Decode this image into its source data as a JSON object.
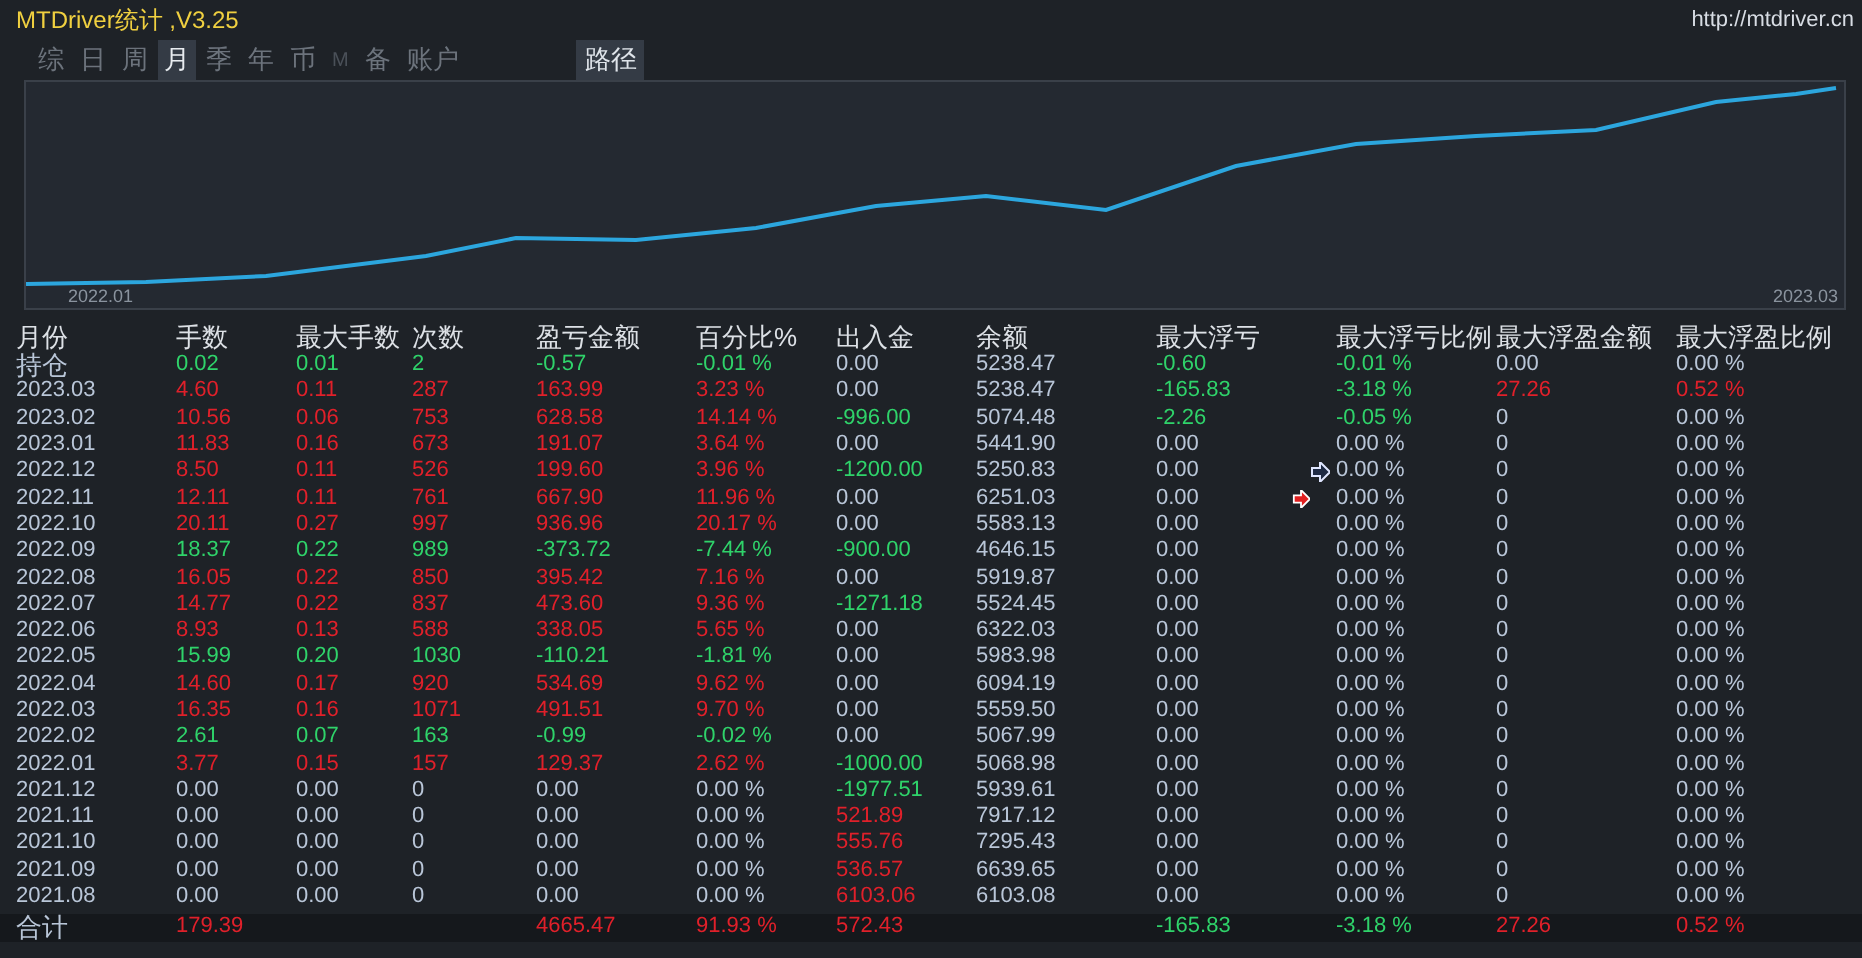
{
  "window": {
    "title": "MTDriver统计 ,V3.25",
    "url": "http://mtdriver.cn"
  },
  "tabs": [
    {
      "label": "综",
      "selected": false,
      "disabled": false
    },
    {
      "label": "日",
      "selected": false,
      "disabled": false
    },
    {
      "label": "周",
      "selected": false,
      "disabled": false
    },
    {
      "label": "月",
      "selected": true,
      "disabled": false
    },
    {
      "label": "季",
      "selected": false,
      "disabled": false
    },
    {
      "label": "年",
      "selected": false,
      "disabled": false
    },
    {
      "label": "币",
      "selected": false,
      "disabled": false
    },
    {
      "label": "M",
      "selected": false,
      "disabled": true
    },
    {
      "label": "备",
      "selected": false,
      "disabled": false
    },
    {
      "label": "账户",
      "selected": false,
      "disabled": false
    }
  ],
  "path_button": "路径",
  "chart": {
    "x_start": "2022.01",
    "x_end": "2023.03"
  },
  "table": {
    "columns": [
      "月份",
      "手数",
      "最大手数",
      "次数",
      "盈亏金额",
      "百分比%",
      "出入金",
      "余额",
      "最大浮亏",
      "最大浮亏比例",
      "最大浮盈金额",
      "最大浮盈比例"
    ],
    "rows": [
      {
        "cells": [
          {
            "text": "持仓",
            "color": "#b9c6d8"
          },
          {
            "text": "0.02",
            "color": "#2fd36a"
          },
          {
            "text": "0.01",
            "color": "#2fd36a"
          },
          {
            "text": "2",
            "color": "#2fd36a"
          },
          {
            "text": "-0.57",
            "color": "#2fd36a"
          },
          {
            "text": "-0.01 %",
            "color": "#2fd36a"
          },
          {
            "text": "0.00",
            "color": "#b9c6d8"
          },
          {
            "text": "5238.47",
            "color": "#b9c6d8"
          },
          {
            "text": "-0.60",
            "color": "#2fd36a"
          },
          {
            "text": "-0.01 %",
            "color": "#2fd36a"
          },
          {
            "text": "0.00",
            "color": "#b9c6d8"
          },
          {
            "text": "0.00 %",
            "color": "#b9c6d8"
          }
        ]
      },
      {
        "cells": [
          {
            "text": "2023.03",
            "color": "#b9c6d8"
          },
          {
            "text": "4.60",
            "color": "#e0202a"
          },
          {
            "text": "0.11",
            "color": "#e0202a"
          },
          {
            "text": "287",
            "color": "#e0202a"
          },
          {
            "text": "163.99",
            "color": "#e0202a"
          },
          {
            "text": "3.23 %",
            "color": "#e0202a"
          },
          {
            "text": "0.00",
            "color": "#b9c6d8"
          },
          {
            "text": "5238.47",
            "color": "#b9c6d8"
          },
          {
            "text": "-165.83",
            "color": "#2fd36a"
          },
          {
            "text": "-3.18 %",
            "color": "#2fd36a"
          },
          {
            "text": "27.26",
            "color": "#e0202a"
          },
          {
            "text": "0.52 %",
            "color": "#e0202a"
          }
        ]
      },
      {
        "cells": [
          {
            "text": "2023.02",
            "color": "#b9c6d8"
          },
          {
            "text": "10.56",
            "color": "#e0202a"
          },
          {
            "text": "0.06",
            "color": "#e0202a"
          },
          {
            "text": "753",
            "color": "#e0202a"
          },
          {
            "text": "628.58",
            "color": "#e0202a"
          },
          {
            "text": "14.14 %",
            "color": "#e0202a"
          },
          {
            "text": "-996.00",
            "color": "#2fd36a"
          },
          {
            "text": "5074.48",
            "color": "#b9c6d8"
          },
          {
            "text": "-2.26",
            "color": "#2fd36a"
          },
          {
            "text": "-0.05 %",
            "color": "#2fd36a"
          },
          {
            "text": "0",
            "color": "#b9c6d8"
          },
          {
            "text": "0.00 %",
            "color": "#b9c6d8"
          }
        ]
      },
      {
        "cells": [
          {
            "text": "2023.01",
            "color": "#b9c6d8"
          },
          {
            "text": "11.83",
            "color": "#e0202a"
          },
          {
            "text": "0.16",
            "color": "#e0202a"
          },
          {
            "text": "673",
            "color": "#e0202a"
          },
          {
            "text": "191.07",
            "color": "#e0202a"
          },
          {
            "text": "3.64 %",
            "color": "#e0202a"
          },
          {
            "text": "0.00",
            "color": "#b9c6d8"
          },
          {
            "text": "5441.90",
            "color": "#b9c6d8"
          },
          {
            "text": "0.00",
            "color": "#b9c6d8"
          },
          {
            "text": "0.00 %",
            "color": "#b9c6d8"
          },
          {
            "text": "0",
            "color": "#b9c6d8"
          },
          {
            "text": "0.00 %",
            "color": "#b9c6d8"
          }
        ]
      },
      {
        "cells": [
          {
            "text": "2022.12",
            "color": "#b9c6d8"
          },
          {
            "text": "8.50",
            "color": "#e0202a"
          },
          {
            "text": "0.11",
            "color": "#e0202a"
          },
          {
            "text": "526",
            "color": "#e0202a"
          },
          {
            "text": "199.60",
            "color": "#e0202a"
          },
          {
            "text": "3.96 %",
            "color": "#e0202a"
          },
          {
            "text": "-1200.00",
            "color": "#2fd36a"
          },
          {
            "text": "5250.83",
            "color": "#b9c6d8"
          },
          {
            "text": "0.00",
            "color": "#b9c6d8"
          },
          {
            "text": "0.00 %",
            "color": "#b9c6d8"
          },
          {
            "text": "0",
            "color": "#b9c6d8"
          },
          {
            "text": "0.00 %",
            "color": "#b9c6d8"
          }
        ]
      },
      {
        "cells": [
          {
            "text": "2022.11",
            "color": "#b9c6d8"
          },
          {
            "text": "12.11",
            "color": "#e0202a"
          },
          {
            "text": "0.11",
            "color": "#e0202a"
          },
          {
            "text": "761",
            "color": "#e0202a"
          },
          {
            "text": "667.90",
            "color": "#e0202a"
          },
          {
            "text": "11.96 %",
            "color": "#e0202a"
          },
          {
            "text": "0.00",
            "color": "#b9c6d8"
          },
          {
            "text": "6251.03",
            "color": "#b9c6d8"
          },
          {
            "text": "0.00",
            "color": "#b9c6d8"
          },
          {
            "text": "0.00 %",
            "color": "#b9c6d8"
          },
          {
            "text": "0",
            "color": "#b9c6d8"
          },
          {
            "text": "0.00 %",
            "color": "#b9c6d8"
          }
        ]
      },
      {
        "cells": [
          {
            "text": "2022.10",
            "color": "#b9c6d8"
          },
          {
            "text": "20.11",
            "color": "#e0202a"
          },
          {
            "text": "0.27",
            "color": "#e0202a"
          },
          {
            "text": "997",
            "color": "#e0202a"
          },
          {
            "text": "936.96",
            "color": "#e0202a"
          },
          {
            "text": "20.17 %",
            "color": "#e0202a"
          },
          {
            "text": "0.00",
            "color": "#b9c6d8"
          },
          {
            "text": "5583.13",
            "color": "#b9c6d8"
          },
          {
            "text": "0.00",
            "color": "#b9c6d8"
          },
          {
            "text": "0.00 %",
            "color": "#b9c6d8"
          },
          {
            "text": "0",
            "color": "#b9c6d8"
          },
          {
            "text": "0.00 %",
            "color": "#b9c6d8"
          }
        ]
      },
      {
        "cells": [
          {
            "text": "2022.09",
            "color": "#b9c6d8"
          },
          {
            "text": "18.37",
            "color": "#2fd36a"
          },
          {
            "text": "0.22",
            "color": "#2fd36a"
          },
          {
            "text": "989",
            "color": "#2fd36a"
          },
          {
            "text": "-373.72",
            "color": "#2fd36a"
          },
          {
            "text": "-7.44 %",
            "color": "#2fd36a"
          },
          {
            "text": "-900.00",
            "color": "#2fd36a"
          },
          {
            "text": "4646.15",
            "color": "#b9c6d8"
          },
          {
            "text": "0.00",
            "color": "#b9c6d8"
          },
          {
            "text": "0.00 %",
            "color": "#b9c6d8"
          },
          {
            "text": "0",
            "color": "#b9c6d8"
          },
          {
            "text": "0.00 %",
            "color": "#b9c6d8"
          }
        ]
      },
      {
        "cells": [
          {
            "text": "2022.08",
            "color": "#b9c6d8"
          },
          {
            "text": "16.05",
            "color": "#e0202a"
          },
          {
            "text": "0.22",
            "color": "#e0202a"
          },
          {
            "text": "850",
            "color": "#e0202a"
          },
          {
            "text": "395.42",
            "color": "#e0202a"
          },
          {
            "text": "7.16 %",
            "color": "#e0202a"
          },
          {
            "text": "0.00",
            "color": "#b9c6d8"
          },
          {
            "text": "5919.87",
            "color": "#b9c6d8"
          },
          {
            "text": "0.00",
            "color": "#b9c6d8"
          },
          {
            "text": "0.00 %",
            "color": "#b9c6d8"
          },
          {
            "text": "0",
            "color": "#b9c6d8"
          },
          {
            "text": "0.00 %",
            "color": "#b9c6d8"
          }
        ]
      },
      {
        "cells": [
          {
            "text": "2022.07",
            "color": "#b9c6d8"
          },
          {
            "text": "14.77",
            "color": "#e0202a"
          },
          {
            "text": "0.22",
            "color": "#e0202a"
          },
          {
            "text": "837",
            "color": "#e0202a"
          },
          {
            "text": "473.60",
            "color": "#e0202a"
          },
          {
            "text": "9.36 %",
            "color": "#e0202a"
          },
          {
            "text": "-1271.18",
            "color": "#2fd36a"
          },
          {
            "text": "5524.45",
            "color": "#b9c6d8"
          },
          {
            "text": "0.00",
            "color": "#b9c6d8"
          },
          {
            "text": "0.00 %",
            "color": "#b9c6d8"
          },
          {
            "text": "0",
            "color": "#b9c6d8"
          },
          {
            "text": "0.00 %",
            "color": "#b9c6d8"
          }
        ]
      },
      {
        "cells": [
          {
            "text": "2022.06",
            "color": "#b9c6d8"
          },
          {
            "text": "8.93",
            "color": "#e0202a"
          },
          {
            "text": "0.13",
            "color": "#e0202a"
          },
          {
            "text": "588",
            "color": "#e0202a"
          },
          {
            "text": "338.05",
            "color": "#e0202a"
          },
          {
            "text": "5.65 %",
            "color": "#e0202a"
          },
          {
            "text": "0.00",
            "color": "#b9c6d8"
          },
          {
            "text": "6322.03",
            "color": "#b9c6d8"
          },
          {
            "text": "0.00",
            "color": "#b9c6d8"
          },
          {
            "text": "0.00 %",
            "color": "#b9c6d8"
          },
          {
            "text": "0",
            "color": "#b9c6d8"
          },
          {
            "text": "0.00 %",
            "color": "#b9c6d8"
          }
        ]
      },
      {
        "cells": [
          {
            "text": "2022.05",
            "color": "#b9c6d8"
          },
          {
            "text": "15.99",
            "color": "#2fd36a"
          },
          {
            "text": "0.20",
            "color": "#2fd36a"
          },
          {
            "text": "1030",
            "color": "#2fd36a"
          },
          {
            "text": "-110.21",
            "color": "#2fd36a"
          },
          {
            "text": "-1.81 %",
            "color": "#2fd36a"
          },
          {
            "text": "0.00",
            "color": "#b9c6d8"
          },
          {
            "text": "5983.98",
            "color": "#b9c6d8"
          },
          {
            "text": "0.00",
            "color": "#b9c6d8"
          },
          {
            "text": "0.00 %",
            "color": "#b9c6d8"
          },
          {
            "text": "0",
            "color": "#b9c6d8"
          },
          {
            "text": "0.00 %",
            "color": "#b9c6d8"
          }
        ]
      },
      {
        "cells": [
          {
            "text": "2022.04",
            "color": "#b9c6d8"
          },
          {
            "text": "14.60",
            "color": "#e0202a"
          },
          {
            "text": "0.17",
            "color": "#e0202a"
          },
          {
            "text": "920",
            "color": "#e0202a"
          },
          {
            "text": "534.69",
            "color": "#e0202a"
          },
          {
            "text": "9.62 %",
            "color": "#e0202a"
          },
          {
            "text": "0.00",
            "color": "#b9c6d8"
          },
          {
            "text": "6094.19",
            "color": "#b9c6d8"
          },
          {
            "text": "0.00",
            "color": "#b9c6d8"
          },
          {
            "text": "0.00 %",
            "color": "#b9c6d8"
          },
          {
            "text": "0",
            "color": "#b9c6d8"
          },
          {
            "text": "0.00 %",
            "color": "#b9c6d8"
          }
        ]
      },
      {
        "cells": [
          {
            "text": "2022.03",
            "color": "#b9c6d8"
          },
          {
            "text": "16.35",
            "color": "#e0202a"
          },
          {
            "text": "0.16",
            "color": "#e0202a"
          },
          {
            "text": "1071",
            "color": "#e0202a"
          },
          {
            "text": "491.51",
            "color": "#e0202a"
          },
          {
            "text": "9.70 %",
            "color": "#e0202a"
          },
          {
            "text": "0.00",
            "color": "#b9c6d8"
          },
          {
            "text": "5559.50",
            "color": "#b9c6d8"
          },
          {
            "text": "0.00",
            "color": "#b9c6d8"
          },
          {
            "text": "0.00 %",
            "color": "#b9c6d8"
          },
          {
            "text": "0",
            "color": "#b9c6d8"
          },
          {
            "text": "0.00 %",
            "color": "#b9c6d8"
          }
        ]
      },
      {
        "cells": [
          {
            "text": "2022.02",
            "color": "#b9c6d8"
          },
          {
            "text": "2.61",
            "color": "#2fd36a"
          },
          {
            "text": "0.07",
            "color": "#2fd36a"
          },
          {
            "text": "163",
            "color": "#2fd36a"
          },
          {
            "text": "-0.99",
            "color": "#2fd36a"
          },
          {
            "text": "-0.02 %",
            "color": "#2fd36a"
          },
          {
            "text": "0.00",
            "color": "#b9c6d8"
          },
          {
            "text": "5067.99",
            "color": "#b9c6d8"
          },
          {
            "text": "0.00",
            "color": "#b9c6d8"
          },
          {
            "text": "0.00 %",
            "color": "#b9c6d8"
          },
          {
            "text": "0",
            "color": "#b9c6d8"
          },
          {
            "text": "0.00 %",
            "color": "#b9c6d8"
          }
        ]
      },
      {
        "cells": [
          {
            "text": "2022.01",
            "color": "#b9c6d8"
          },
          {
            "text": "3.77",
            "color": "#e0202a"
          },
          {
            "text": "0.15",
            "color": "#e0202a"
          },
          {
            "text": "157",
            "color": "#e0202a"
          },
          {
            "text": "129.37",
            "color": "#e0202a"
          },
          {
            "text": "2.62 %",
            "color": "#e0202a"
          },
          {
            "text": "-1000.00",
            "color": "#2fd36a"
          },
          {
            "text": "5068.98",
            "color": "#b9c6d8"
          },
          {
            "text": "0.00",
            "color": "#b9c6d8"
          },
          {
            "text": "0.00 %",
            "color": "#b9c6d8"
          },
          {
            "text": "0",
            "color": "#b9c6d8"
          },
          {
            "text": "0.00 %",
            "color": "#b9c6d8"
          }
        ]
      },
      {
        "cells": [
          {
            "text": "2021.12",
            "color": "#b9c6d8"
          },
          {
            "text": "0.00",
            "color": "#b9c6d8"
          },
          {
            "text": "0.00",
            "color": "#b9c6d8"
          },
          {
            "text": "0",
            "color": "#b9c6d8"
          },
          {
            "text": "0.00",
            "color": "#b9c6d8"
          },
          {
            "text": "0.00 %",
            "color": "#b9c6d8"
          },
          {
            "text": "-1977.51",
            "color": "#2fd36a"
          },
          {
            "text": "5939.61",
            "color": "#b9c6d8"
          },
          {
            "text": "0.00",
            "color": "#b9c6d8"
          },
          {
            "text": "0.00 %",
            "color": "#b9c6d8"
          },
          {
            "text": "0",
            "color": "#b9c6d8"
          },
          {
            "text": "0.00 %",
            "color": "#b9c6d8"
          }
        ]
      },
      {
        "cells": [
          {
            "text": "2021.11",
            "color": "#b9c6d8"
          },
          {
            "text": "0.00",
            "color": "#b9c6d8"
          },
          {
            "text": "0.00",
            "color": "#b9c6d8"
          },
          {
            "text": "0",
            "color": "#b9c6d8"
          },
          {
            "text": "0.00",
            "color": "#b9c6d8"
          },
          {
            "text": "0.00 %",
            "color": "#b9c6d8"
          },
          {
            "text": "521.89",
            "color": "#e0202a"
          },
          {
            "text": "7917.12",
            "color": "#b9c6d8"
          },
          {
            "text": "0.00",
            "color": "#b9c6d8"
          },
          {
            "text": "0.00 %",
            "color": "#b9c6d8"
          },
          {
            "text": "0",
            "color": "#b9c6d8"
          },
          {
            "text": "0.00 %",
            "color": "#b9c6d8"
          }
        ]
      },
      {
        "cells": [
          {
            "text": "2021.10",
            "color": "#b9c6d8"
          },
          {
            "text": "0.00",
            "color": "#b9c6d8"
          },
          {
            "text": "0.00",
            "color": "#b9c6d8"
          },
          {
            "text": "0",
            "color": "#b9c6d8"
          },
          {
            "text": "0.00",
            "color": "#b9c6d8"
          },
          {
            "text": "0.00 %",
            "color": "#b9c6d8"
          },
          {
            "text": "555.76",
            "color": "#e0202a"
          },
          {
            "text": "7295.43",
            "color": "#b9c6d8"
          },
          {
            "text": "0.00",
            "color": "#b9c6d8"
          },
          {
            "text": "0.00 %",
            "color": "#b9c6d8"
          },
          {
            "text": "0",
            "color": "#b9c6d8"
          },
          {
            "text": "0.00 %",
            "color": "#b9c6d8"
          }
        ]
      },
      {
        "cells": [
          {
            "text": "2021.09",
            "color": "#b9c6d8"
          },
          {
            "text": "0.00",
            "color": "#b9c6d8"
          },
          {
            "text": "0.00",
            "color": "#b9c6d8"
          },
          {
            "text": "0",
            "color": "#b9c6d8"
          },
          {
            "text": "0.00",
            "color": "#b9c6d8"
          },
          {
            "text": "0.00 %",
            "color": "#b9c6d8"
          },
          {
            "text": "536.57",
            "color": "#e0202a"
          },
          {
            "text": "6639.65",
            "color": "#b9c6d8"
          },
          {
            "text": "0.00",
            "color": "#b9c6d8"
          },
          {
            "text": "0.00 %",
            "color": "#b9c6d8"
          },
          {
            "text": "0",
            "color": "#b9c6d8"
          },
          {
            "text": "0.00 %",
            "color": "#b9c6d8"
          }
        ]
      },
      {
        "cells": [
          {
            "text": "2021.08",
            "color": "#b9c6d8"
          },
          {
            "text": "0.00",
            "color": "#b9c6d8"
          },
          {
            "text": "0.00",
            "color": "#b9c6d8"
          },
          {
            "text": "0",
            "color": "#b9c6d8"
          },
          {
            "text": "0.00",
            "color": "#b9c6d8"
          },
          {
            "text": "0.00 %",
            "color": "#b9c6d8"
          },
          {
            "text": "6103.06",
            "color": "#e0202a"
          },
          {
            "text": "6103.08",
            "color": "#b9c6d8"
          },
          {
            "text": "0.00",
            "color": "#b9c6d8"
          },
          {
            "text": "0.00 %",
            "color": "#b9c6d8"
          },
          {
            "text": "0",
            "color": "#b9c6d8"
          },
          {
            "text": "0.00 %",
            "color": "#b9c6d8"
          }
        ]
      }
    ],
    "total": [
      {
        "kind": "value",
        "text": "合计",
        "color": "#b9c6d8"
      },
      {
        "kind": "value",
        "text": "179.39",
        "color": "#e0202a"
      },
      {
        "kind": "blank"
      },
      {
        "kind": "blank"
      },
      {
        "kind": "value",
        "text": "4665.47",
        "color": "#e0202a"
      },
      {
        "kind": "value",
        "text": "91.93 %",
        "color": "#e0202a"
      },
      {
        "kind": "value",
        "text": "572.43",
        "color": "#e0202a"
      },
      {
        "kind": "blank"
      },
      {
        "kind": "value",
        "text": "-165.83",
        "color": "#2fd36a"
      },
      {
        "kind": "value",
        "text": "-3.18 %",
        "color": "#2fd36a"
      },
      {
        "kind": "value",
        "text": "27.26",
        "color": "#e0202a"
      },
      {
        "kind": "value",
        "text": "0.52 %",
        "color": "#e0202a"
      }
    ]
  }
}
